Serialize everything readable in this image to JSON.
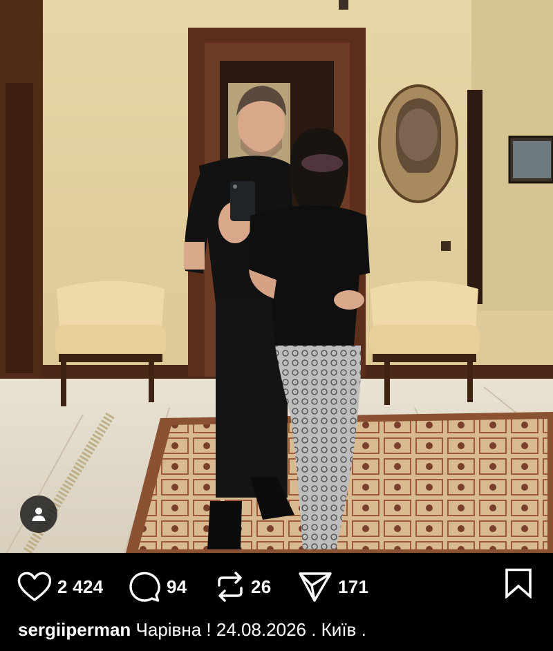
{
  "post": {
    "likes": "2 424",
    "comments": "94",
    "reposts": "26",
    "shares": "171"
  },
  "caption": {
    "username": "sergiiperman",
    "text": "Чарівна ! 24.08.2026 . Київ ."
  },
  "icons": {
    "like": "heart-icon",
    "comment": "comment-bubble-icon",
    "repost": "repost-arrows-icon",
    "share": "send-paper-plane-icon",
    "bookmark": "bookmark-icon",
    "user_tag": "person-icon"
  },
  "colors": {
    "background": "#000000",
    "text": "#ffffff"
  }
}
